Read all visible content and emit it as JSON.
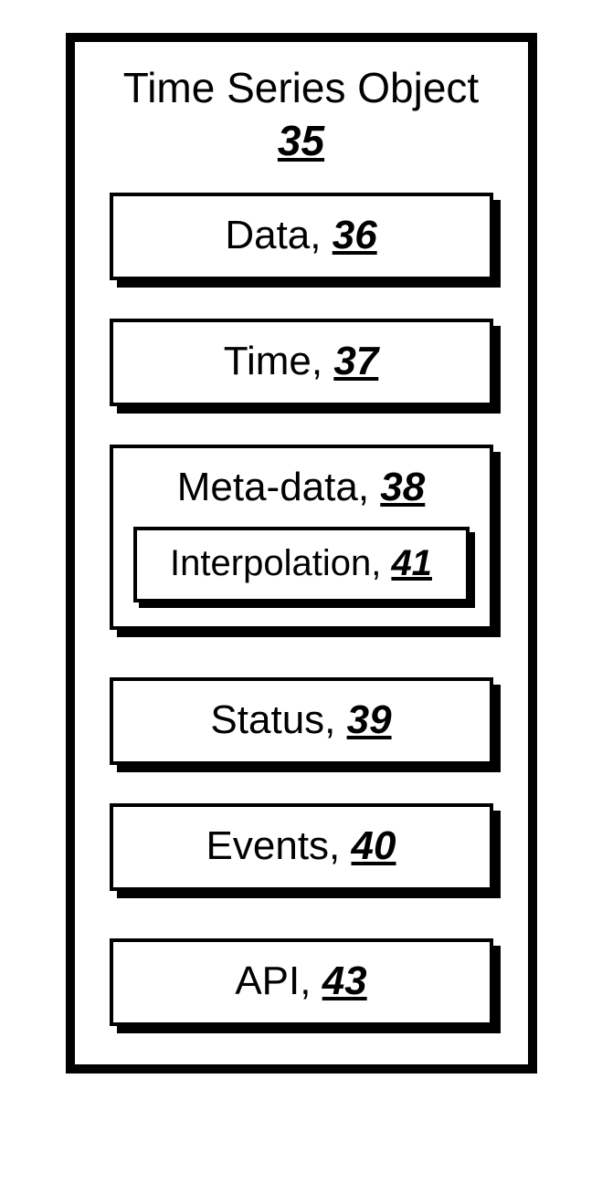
{
  "title": {
    "text": "Time Series Object",
    "num": "35"
  },
  "boxes": {
    "data": {
      "label": "Data, ",
      "num": "36"
    },
    "time": {
      "label": "Time, ",
      "num": "37"
    },
    "meta": {
      "label": "Meta-data, ",
      "num": "38"
    },
    "interp": {
      "label": "Interpolation, ",
      "num": "41"
    },
    "status": {
      "label": "Status, ",
      "num": "39"
    },
    "events": {
      "label": "Events, ",
      "num": "40"
    },
    "api": {
      "label": "API, ",
      "num": "43"
    }
  }
}
